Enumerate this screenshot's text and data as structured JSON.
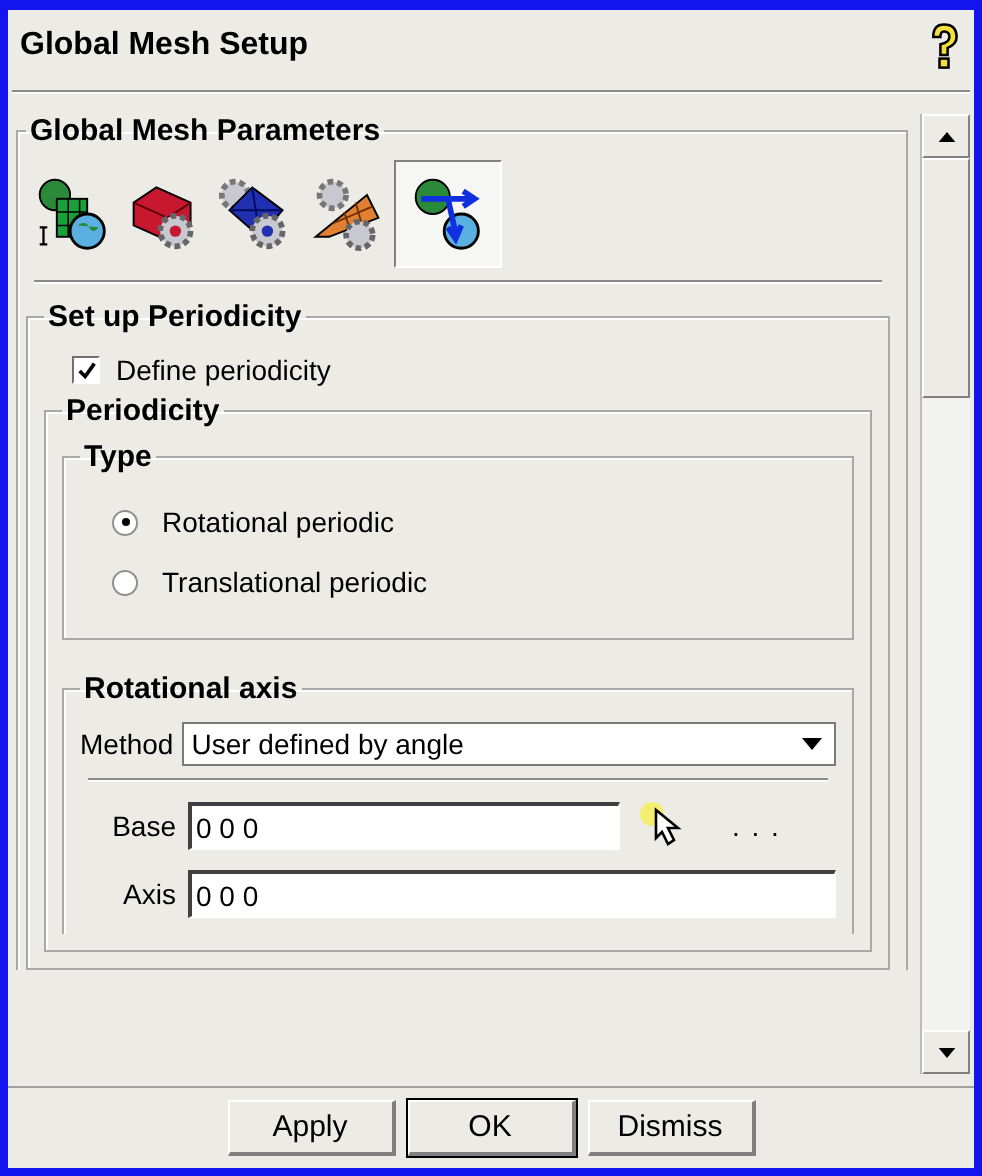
{
  "window": {
    "title": "Global Mesh Setup"
  },
  "panel": {
    "title": "Global Mesh Parameters",
    "toolbar": [
      {
        "kind": "globe-grid",
        "selected": false
      },
      {
        "kind": "red-block-gear",
        "selected": false
      },
      {
        "kind": "blue-block-gear",
        "selected": false
      },
      {
        "kind": "orange-wedge-gear",
        "selected": false
      },
      {
        "kind": "globe-arrows",
        "selected": true
      }
    ]
  },
  "setup": {
    "title": "Set up Periodicity",
    "define": {
      "label": "Define periodicity",
      "checked": true
    },
    "periodicity": {
      "title": "Periodicity",
      "type": {
        "title": "Type",
        "options": [
          {
            "label": "Rotational periodic",
            "selected": true
          },
          {
            "label": "Translational periodic",
            "selected": false
          }
        ]
      },
      "axis_group": {
        "title": "Rotational axis",
        "method": {
          "label": "Method",
          "value": "User defined by angle"
        },
        "base": {
          "label": "Base",
          "value": "0 0 0"
        },
        "browse": ". . .",
        "axis": {
          "label": "Axis",
          "value": "0 0 0"
        }
      }
    }
  },
  "buttons": [
    "Apply",
    "OK",
    "Dismiss"
  ]
}
